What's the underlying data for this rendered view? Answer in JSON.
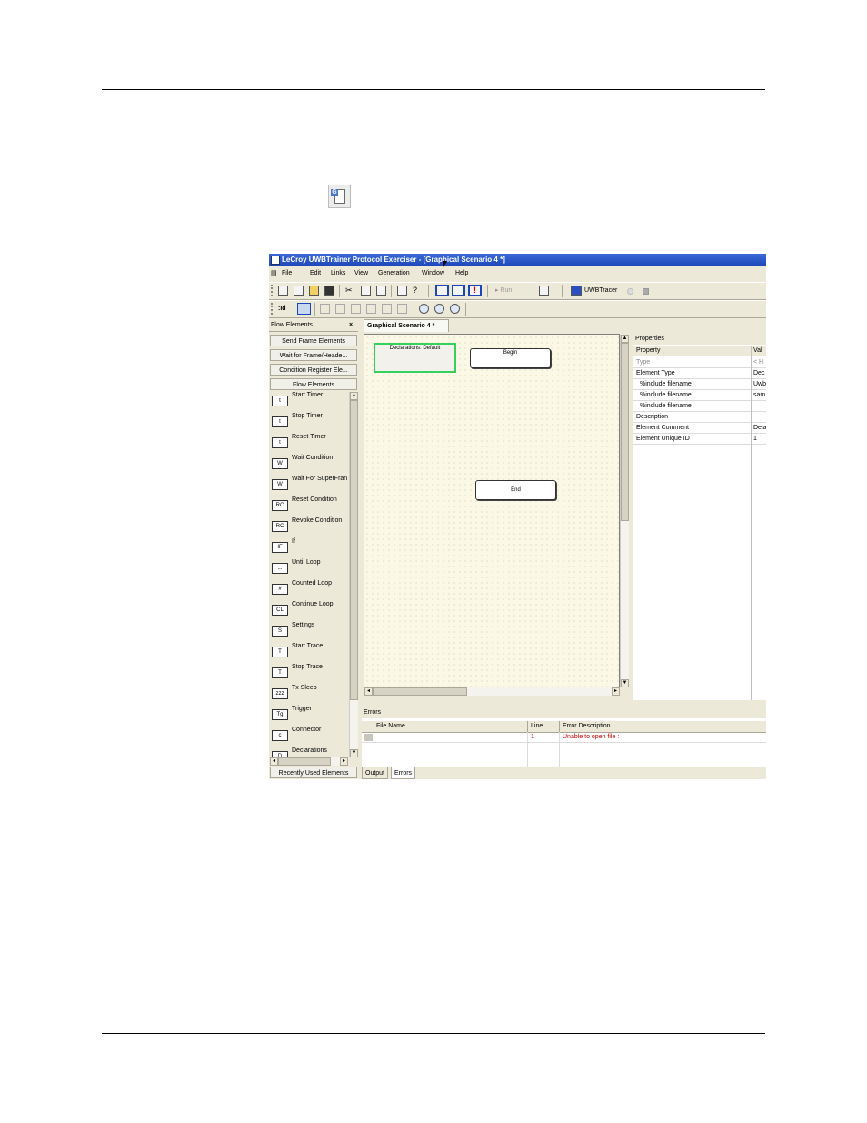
{
  "app": {
    "title": "LeCroy UWBTrainer Protocol Exerciser - [Graphical Scenario 4 *]",
    "menus": [
      "File",
      "Edit",
      "Links",
      "View",
      "Generation",
      "Window",
      "Help"
    ]
  },
  "toolbar": {
    "run_label": "Run",
    "uwbtracer_label": "UWBTracer",
    "id_label": ":Id"
  },
  "left_pane": {
    "title": "Flow Elements",
    "close_glyph": "×",
    "categories": [
      "Send Frame Elements",
      "Wait for Frame/Heade...",
      "Condition Register Ele...",
      "Flow Elements"
    ],
    "items": [
      {
        "label": "Start Timer",
        "glyph": "t"
      },
      {
        "label": "Stop Timer",
        "glyph": "t"
      },
      {
        "label": "Reset Timer",
        "glyph": "t"
      },
      {
        "label": "Wait Condition",
        "glyph": "W"
      },
      {
        "label": "Wait For SuperFran",
        "glyph": "W"
      },
      {
        "label": "Reset Condition",
        "glyph": "RC"
      },
      {
        "label": "Revoke Condition",
        "glyph": "RC"
      },
      {
        "label": "If",
        "glyph": "IF"
      },
      {
        "label": "Until Loop",
        "glyph": "..."
      },
      {
        "label": "Counted Loop",
        "glyph": "#"
      },
      {
        "label": "Continue Loop",
        "glyph": "CL"
      },
      {
        "label": "Settings",
        "glyph": "S"
      },
      {
        "label": "Start Trace",
        "glyph": "T"
      },
      {
        "label": "Stop Trace",
        "glyph": "T"
      },
      {
        "label": "Tx Sleep",
        "glyph": "zzz"
      },
      {
        "label": "Trigger",
        "glyph": "Tg"
      },
      {
        "label": "Connector",
        "glyph": "c"
      },
      {
        "label": "Declarations",
        "glyph": "D"
      }
    ],
    "footer": "Recently Used Elements"
  },
  "document": {
    "tab_label": "Graphical Scenario 4 *",
    "nodes": {
      "declarations": "Declarations: Default",
      "begin": "Begin",
      "end": "End"
    }
  },
  "properties": {
    "title": "Properties",
    "headers": [
      "Property",
      "Val"
    ],
    "rows": [
      {
        "key": "Type",
        "value": "< H"
      },
      {
        "key": "Element Type",
        "value": "Dec"
      },
      {
        "key": "%include filename",
        "value": "Uwb"
      },
      {
        "key": "%include filename",
        "value": "sam"
      },
      {
        "key": "%include filename",
        "value": ""
      },
      {
        "key": "Description",
        "value": ""
      },
      {
        "key": "Element Comment",
        "value": "Dela"
      },
      {
        "key": "Element Unique ID",
        "value": "1"
      }
    ]
  },
  "errors": {
    "title": "Errors",
    "headers": [
      "File Name",
      "Line",
      "Error Description"
    ],
    "rows": [
      {
        "file": "",
        "line": "1",
        "desc": "Unable to open file :"
      }
    ],
    "tabs": [
      "Output",
      "Errors"
    ]
  },
  "colors": {
    "title_bar": "#1c46b8",
    "canvas": "#fbf9e6",
    "selection": "#35d15f",
    "error_text": "#cc0000"
  }
}
